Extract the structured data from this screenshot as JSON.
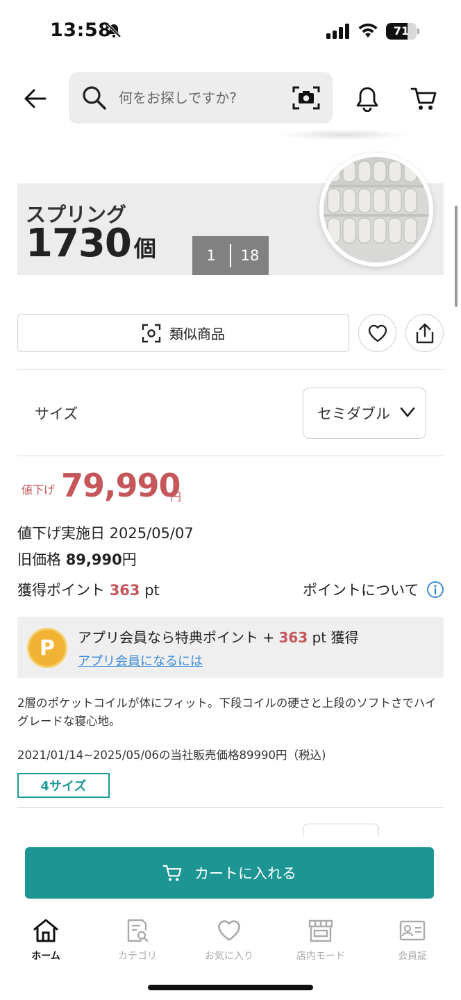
{
  "status_bar": {
    "time": "13:58",
    "battery": "71",
    "battery_level": 0.71
  },
  "search": {
    "placeholder": "何をお探しですか?"
  },
  "hero": {
    "label": "スプリング",
    "count": "1730",
    "unit": "個",
    "current_image": "1",
    "total_images": "18"
  },
  "actions": {
    "similar_label": "類似商品"
  },
  "size": {
    "label": "サイズ",
    "selected": "セミダブル"
  },
  "price": {
    "badge": "値下げ",
    "value": "79,990",
    "unit": "円",
    "reduced_date": "値下げ実施日 2025/05/07",
    "old_price_label": "旧価格",
    "old_price_value": "89,990",
    "old_price_unit": "円",
    "points_label": "獲得ポイント",
    "points_value": "363",
    "points_unit": "pt",
    "points_link": "ポイントについて"
  },
  "member": {
    "icon_letter": "P",
    "text_before": "アプリ会員なら特典ポイント + ",
    "points": "363",
    "text_after": " pt 獲得",
    "link": "アプリ会員になるには"
  },
  "description": "2層のポケットコイルが体にフィット。下段コイルの硬さと上段のソフトさでハイグレードな寝心地。",
  "price_note": "2021/01/14~2025/05/06の当社販売価格89990円（税込)",
  "sizes_tag": "4サイズ",
  "cart_button": "カートに入れる",
  "tabbar": [
    {
      "label": "ホーム",
      "icon": "home-icon",
      "active": true
    },
    {
      "label": "カテゴリ",
      "icon": "category-search-icon",
      "active": false
    },
    {
      "label": "お気に入り",
      "icon": "heart-icon",
      "active": false
    },
    {
      "label": "店内モード",
      "icon": "store-icon",
      "active": false
    },
    {
      "label": "会員証",
      "icon": "member-card-icon",
      "active": false
    }
  ],
  "colors": {
    "accent": "#1d9592",
    "price": "#c5565a",
    "link": "#3b8bd8",
    "point_badge": "#f2b233"
  }
}
